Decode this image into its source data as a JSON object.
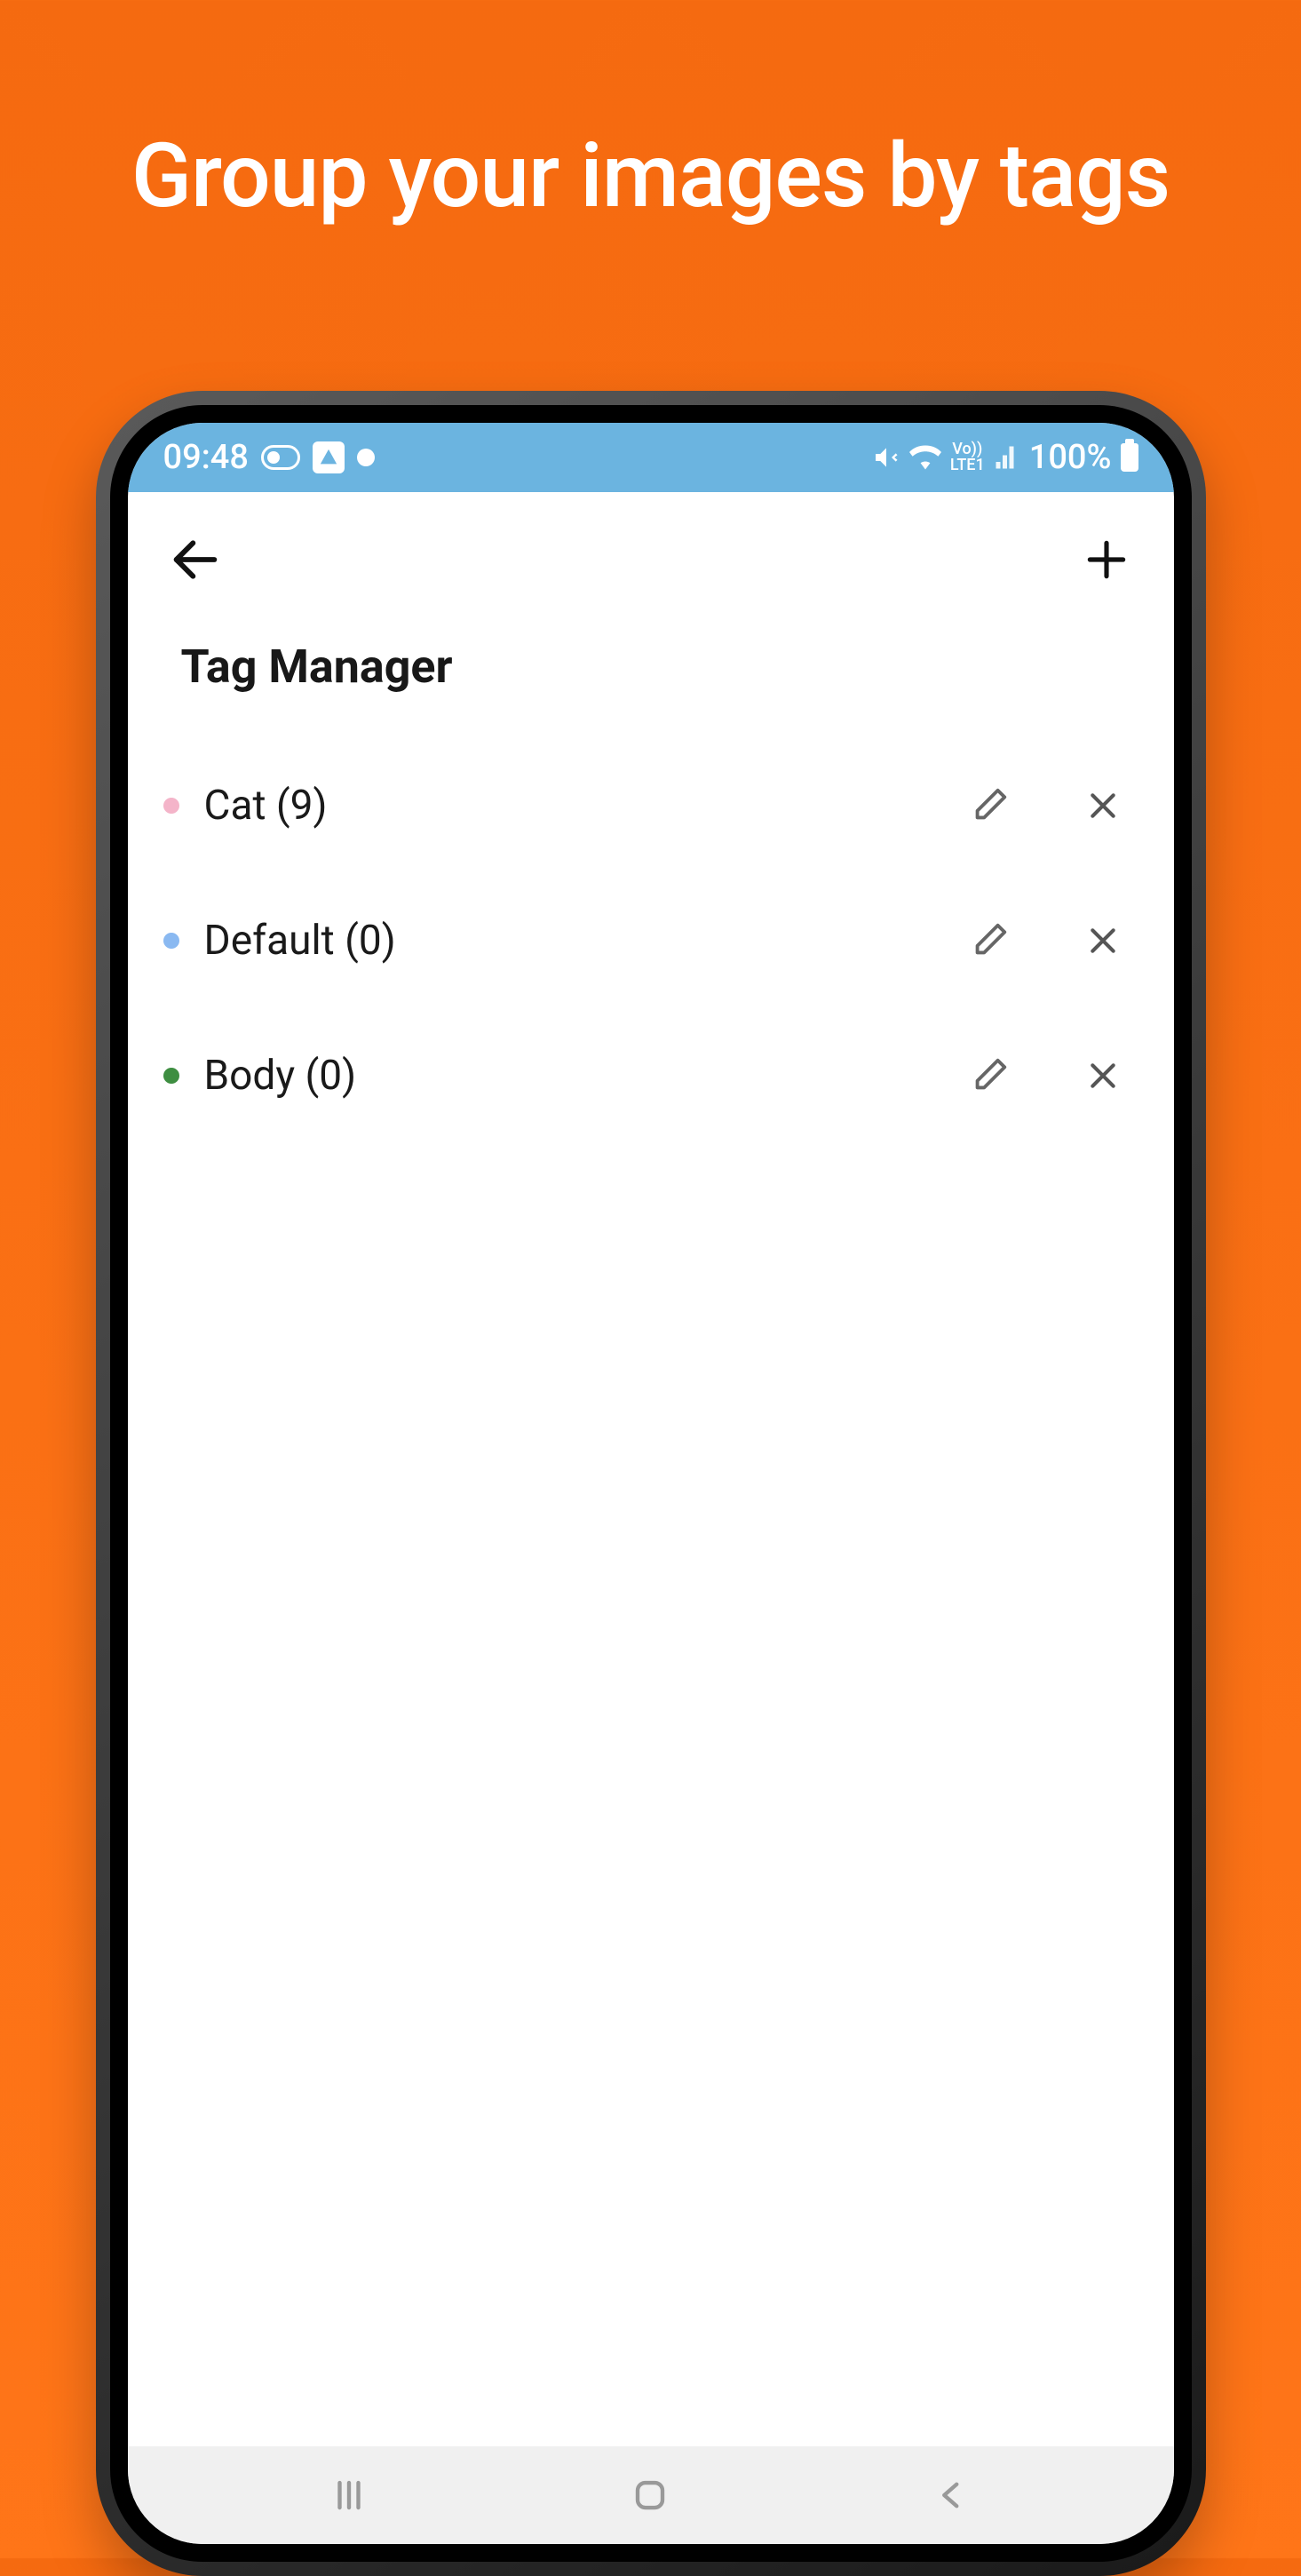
{
  "headline": "Group your images by tags",
  "status": {
    "time": "09:48",
    "network_label": "Vo))\nLTE1",
    "battery": "100%"
  },
  "app": {
    "title": "Tag Manager"
  },
  "tags": [
    {
      "name": "Cat",
      "count": 9,
      "color": "#F4B4C9"
    },
    {
      "name": "Default",
      "count": 0,
      "color": "#8AB9F1"
    },
    {
      "name": "Body",
      "count": 0,
      "color": "#3E8E41"
    }
  ]
}
